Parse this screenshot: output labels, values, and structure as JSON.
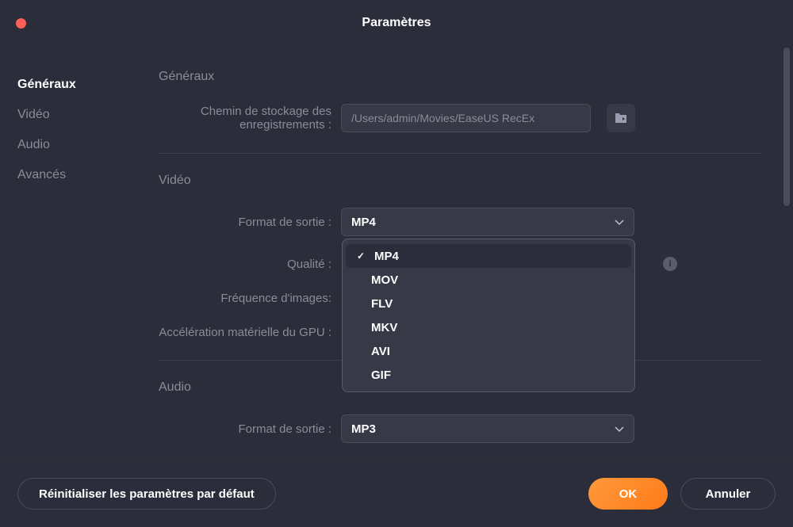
{
  "window": {
    "title": "Paramètres"
  },
  "sidebar": {
    "items": [
      {
        "label": "Généraux",
        "active": true
      },
      {
        "label": "Vidéo",
        "active": false
      },
      {
        "label": "Audio",
        "active": false
      },
      {
        "label": "Avancés",
        "active": false
      }
    ]
  },
  "sections": {
    "general": {
      "title": "Généraux",
      "storage_path_label": "Chemin de stockage des enregistrements :",
      "storage_path_value": "/Users/admin/Movies/EaseUS RecEx"
    },
    "video": {
      "title": "Vidéo",
      "format_label": "Format de sortie :",
      "format_value": "MP4",
      "format_options": [
        "MP4",
        "MOV",
        "FLV",
        "MKV",
        "AVI",
        "GIF"
      ],
      "quality_label": "Qualité :",
      "framerate_label": "Fréquence d'images:",
      "gpu_label": "Accélération matérielle du GPU :"
    },
    "audio": {
      "title": "Audio",
      "format_label": "Format de sortie :",
      "format_value": "MP3"
    }
  },
  "footer": {
    "reset_label": "Réinitialiser les paramètres par défaut",
    "ok_label": "OK",
    "cancel_label": "Annuler"
  },
  "colors": {
    "accent": "#ff7a18",
    "background": "#2b2d3a",
    "panel": "#373947",
    "text_muted": "#8a8c99"
  }
}
